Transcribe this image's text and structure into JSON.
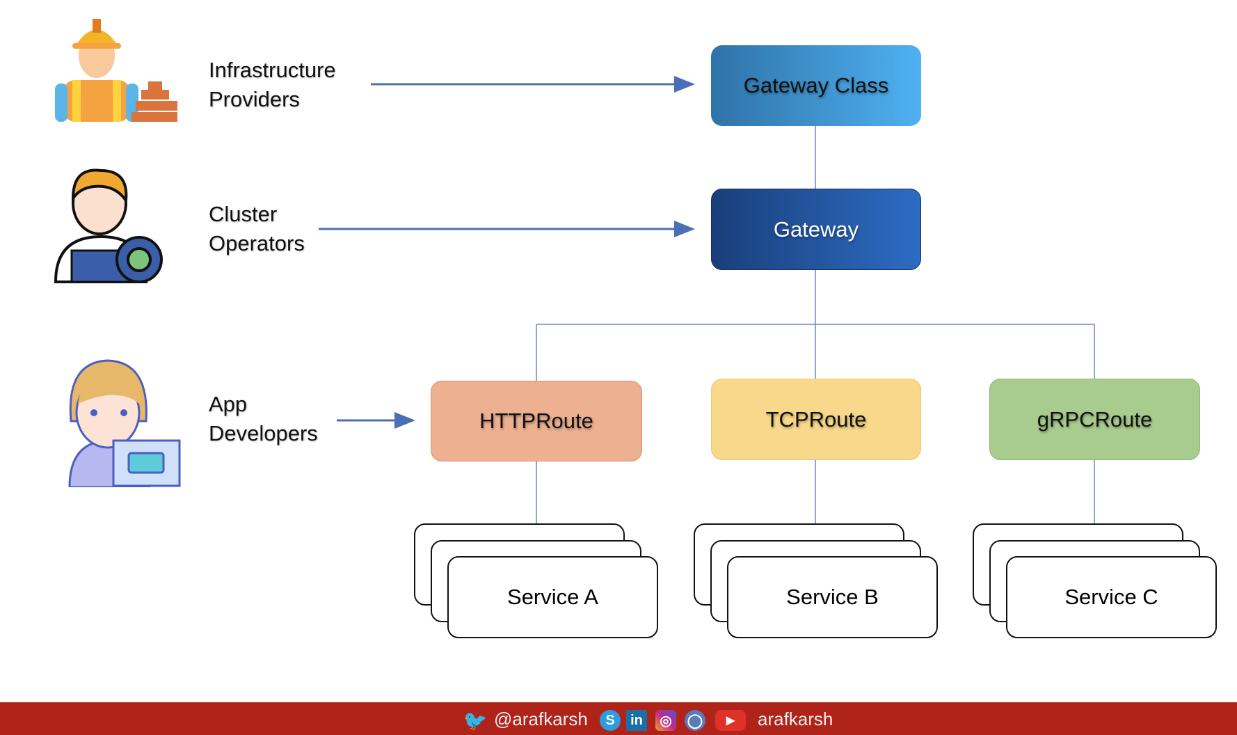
{
  "roles": [
    {
      "label_line1": "Infrastructure",
      "label_line2": "Providers",
      "icon": "construction-worker-icon"
    },
    {
      "label_line1": "Cluster",
      "label_line2": "Operators",
      "icon": "operator-gear-icon"
    },
    {
      "label_line1": "App",
      "label_line2": "Developers",
      "icon": "developer-laptop-icon"
    }
  ],
  "nodes": {
    "gateway_class": "Gateway Class",
    "gateway": "Gateway",
    "http_route": "HTTPRoute",
    "tcp_route": "TCPRoute",
    "grpc_route": "gRPCRoute",
    "service_a": "Service A",
    "service_b": "Service B",
    "service_c": "Service C"
  },
  "colors": {
    "footer": "#b02318",
    "connector": "#4a6fb5"
  },
  "footer": {
    "twitter_handle": "@arafkarsh",
    "youtube_handle": "arafkarsh",
    "icons": [
      "twitter-icon",
      "skype-icon",
      "linkedin-icon",
      "instagram-icon",
      "github-icon",
      "youtube-icon"
    ]
  }
}
